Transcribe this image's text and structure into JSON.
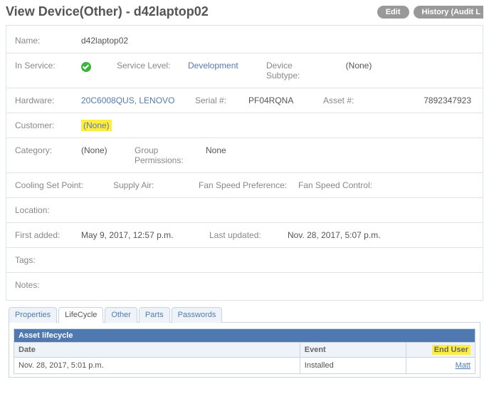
{
  "header": {
    "title": "View Device(Other) - d42laptop02",
    "edit_label": "Edit",
    "history_label": "History (Audit L"
  },
  "fields": {
    "name_label": "Name:",
    "name_value": "d42laptop02",
    "in_service_label": "In Service:",
    "service_level_label": "Service Level:",
    "service_level_value": "Development",
    "device_subtype_label": "Device Subtype:",
    "device_subtype_value": "(None)",
    "hardware_label": "Hardware:",
    "hardware_value": "20C6008QUS, LENOVO",
    "serial_label": "Serial #:",
    "serial_value": "PF04RQNA",
    "asset_num_label": "Asset #:",
    "asset_num_value": "7892347923",
    "customer_label": "Customer:",
    "customer_value": "(None)",
    "category_label": "Category:",
    "category_value": "(None)",
    "group_perms_label": "Group Permissions:",
    "group_perms_value": "None",
    "cooling_label": "Cooling Set Point:",
    "supply_air_label": "Supply Air:",
    "fan_pref_label": "Fan Speed Preference:",
    "fan_ctrl_label": "Fan Speed Control:",
    "location_label": "Location:",
    "first_added_label": "First added:",
    "first_added_value": "May 9, 2017, 12:57 p.m.",
    "last_updated_label": "Last updated:",
    "last_updated_value": "Nov. 28, 2017, 5:07 p.m.",
    "tags_label": "Tags:",
    "notes_label": "Notes:"
  },
  "tabs": {
    "properties": "Properties",
    "lifecycle": "LifeCycle",
    "other": "Other",
    "parts": "Parts",
    "passwords": "Passwords"
  },
  "lifecycle_section": {
    "title": "Asset lifecycle",
    "columns": {
      "date": "Date",
      "event": "Event",
      "end_user": "End User"
    },
    "rows": [
      {
        "date": "Nov. 28, 2017, 5:01 p.m.",
        "event": "Installed",
        "end_user": "Matt"
      }
    ]
  }
}
